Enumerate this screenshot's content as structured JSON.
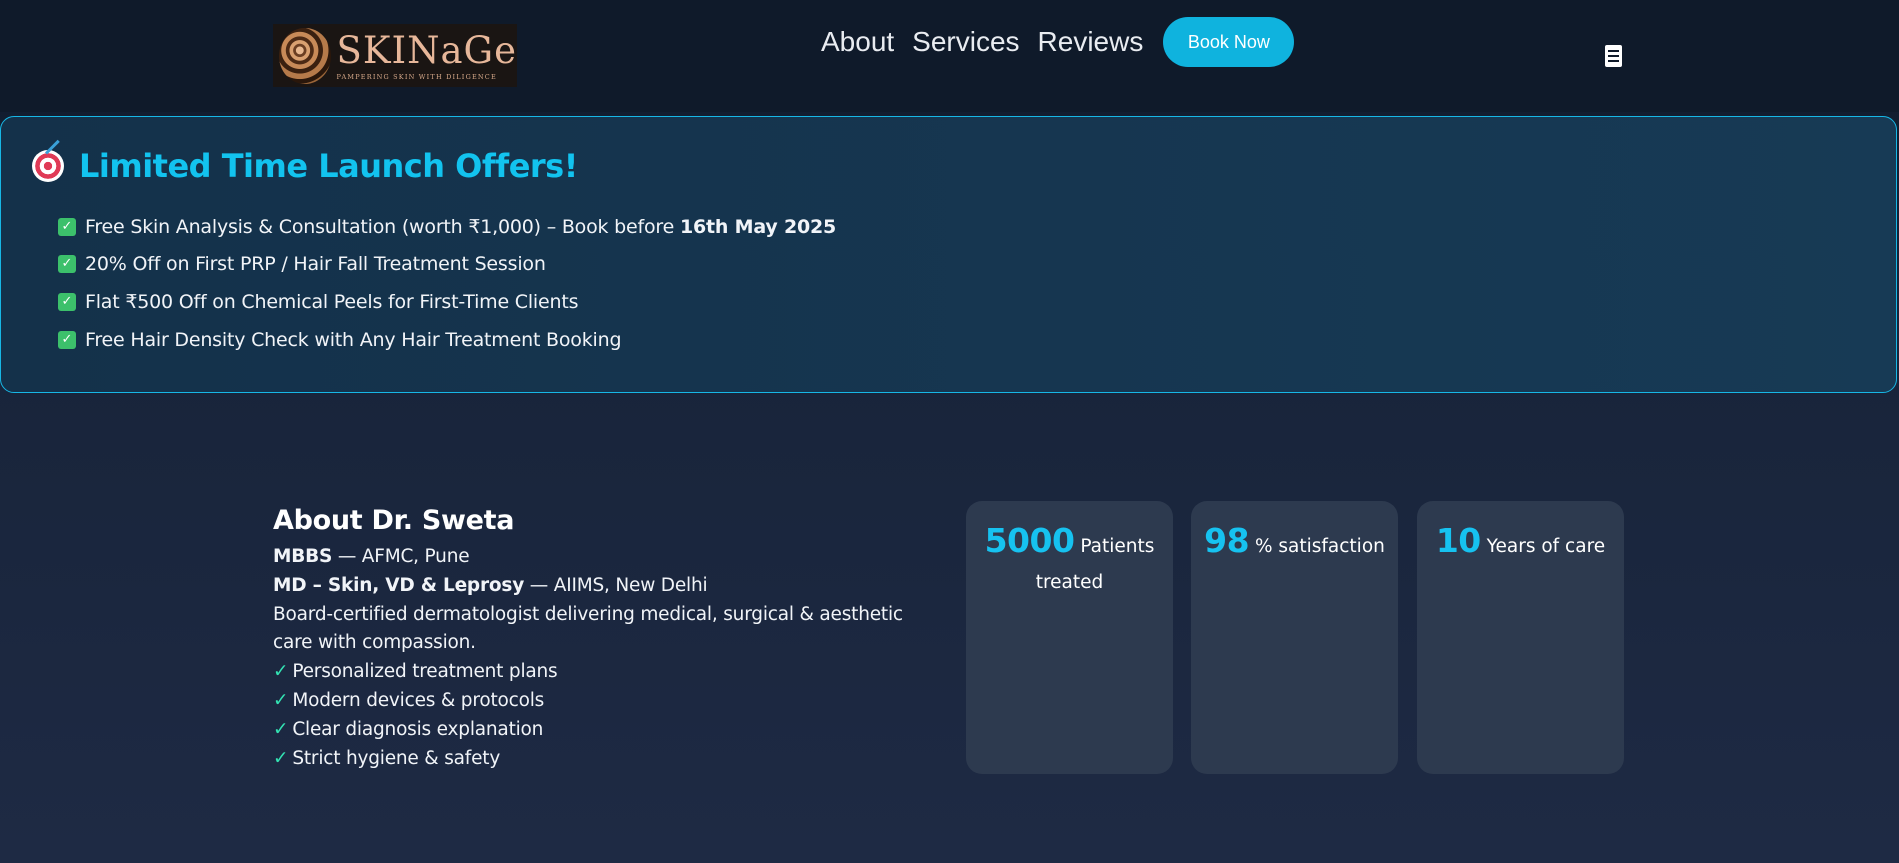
{
  "header": {
    "logo": {
      "word": "SKINaGe",
      "tagline": "PAMPERING SKIN WITH DILIGENCE"
    },
    "nav": [
      {
        "label": "About"
      },
      {
        "label": "Services"
      },
      {
        "label": "Reviews"
      }
    ],
    "book_button": "Book Now",
    "menu_icon": "hamburger-menu-icon"
  },
  "offers": {
    "icon": "target-dart-icon",
    "title": "Limited Time Launch Offers!",
    "items": [
      {
        "text": "Free Skin Analysis & Consultation (worth ₹1,000) – Book before ",
        "bold": "16th May 2025"
      },
      {
        "text": "20% Off on First PRP / Hair Fall Treatment Session",
        "bold": ""
      },
      {
        "text": "Flat ₹500 Off on Chemical Peels for First-Time Clients",
        "bold": ""
      },
      {
        "text": "Free Hair Density Check with Any Hair Treatment Booking",
        "bold": ""
      }
    ],
    "colors": {
      "accent": "#12c3ef",
      "check": "#3cc06b"
    }
  },
  "about": {
    "title": "About Dr. Sweta",
    "qualifications": [
      {
        "degree": "MBBS",
        "institute": " — AFMC, Pune"
      },
      {
        "degree": "MD – Skin, VD & Leprosy",
        "institute": " — AIIMS, New Delhi"
      }
    ],
    "bio_line1": "Board-certified dermatologist delivering medical, surgical & aesthetic",
    "bio_line2": "care with compassion.",
    "points": [
      "Personalized treatment plans",
      "Modern devices & protocols",
      "Clear diagnosis explanation",
      "Strict hygiene & safety"
    ],
    "tick": "✓"
  },
  "stats": [
    {
      "value": "5000",
      "label": "Patients",
      "label2": "treated"
    },
    {
      "value": "98",
      "label": "% satisfaction",
      "label2": ""
    },
    {
      "value": "10",
      "label": "Years of care",
      "label2": ""
    }
  ]
}
